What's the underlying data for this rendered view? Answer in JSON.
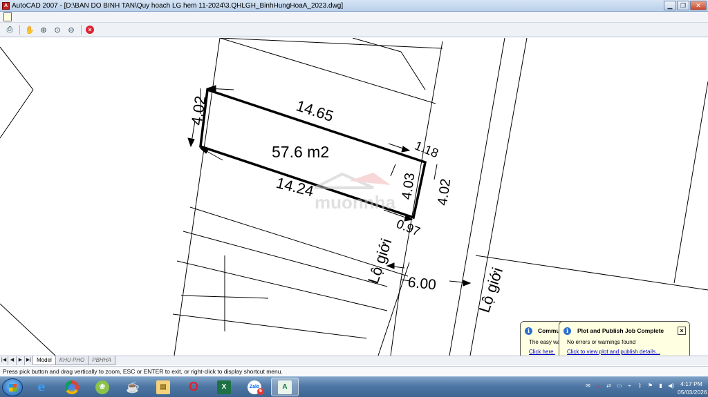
{
  "window": {
    "title": "AutoCAD 2007 - [D:\\BAN DO BINH TAN\\Quy hoach LG hem 11-2024\\3.QHLGH_BinhHungHoaA_2023.dwg]",
    "app_icon": "autocad-icon",
    "controls": [
      "minimize",
      "restore",
      "close"
    ]
  },
  "toolbar": {
    "icons": [
      "plot-icon",
      "pan-icon",
      "zoom-realtime-icon",
      "zoom-window-icon",
      "zoom-previous-icon",
      "close-preview-icon"
    ]
  },
  "drawing": {
    "dimensions": {
      "top": "14.65",
      "left": "4.02",
      "bottom": "14.24",
      "inner_right": "4.03",
      "outer_right": "4.02",
      "top_right_offset": "1.18",
      "bottom_right_offset": "0.97",
      "road_width": "6.00"
    },
    "area_label": "57.6 m2",
    "road_labels": [
      "Lộ giới",
      "Lộ giới"
    ],
    "watermark": "muonnha",
    "colors": {
      "lines": "#000000",
      "parcel": "#000000",
      "watermark": "#d0d0d0"
    }
  },
  "layout_tabs": {
    "nav": [
      "|◀",
      "◀",
      "▶",
      "▶|"
    ],
    "tabs": [
      "Model",
      "KHU PHO",
      "PBHHA"
    ],
    "active": "Model"
  },
  "command_line": {
    "text": "Press pick button and drag vertically to zoom, ESC or ENTER to exit, or right-click to display shortcut menu."
  },
  "notifications": {
    "back": {
      "title": "Commu",
      "line": "The easy wa",
      "link": "Click here."
    },
    "front": {
      "title": "Plot and Publish Job Complete",
      "line": "No errors or warnings found",
      "link": "Click to view plot and publish details..."
    }
  },
  "taskbar": {
    "apps": [
      {
        "name": "ie-icon",
        "glyph": "e"
      },
      {
        "name": "chrome-icon",
        "glyph": "◉"
      },
      {
        "name": "app-icon",
        "glyph": "❀"
      },
      {
        "name": "coffee-icon",
        "glyph": "☕"
      },
      {
        "name": "folder-icon",
        "glyph": "▤"
      },
      {
        "name": "opera-icon",
        "glyph": "O"
      },
      {
        "name": "excel-icon",
        "glyph": "X"
      },
      {
        "name": "zalo-icon",
        "glyph": "Zalo"
      },
      {
        "name": "autocad-icon",
        "glyph": "A"
      }
    ],
    "zalo_badge": "6",
    "tray_icons": [
      "mail-icon",
      "v-icon",
      "network-icon",
      "monitor-icon",
      "usb-icon",
      "bluetooth-icon",
      "flag-icon",
      "signal-icon",
      "volume-icon"
    ],
    "time": "4:17 PM",
    "date": "05/03/2026"
  }
}
